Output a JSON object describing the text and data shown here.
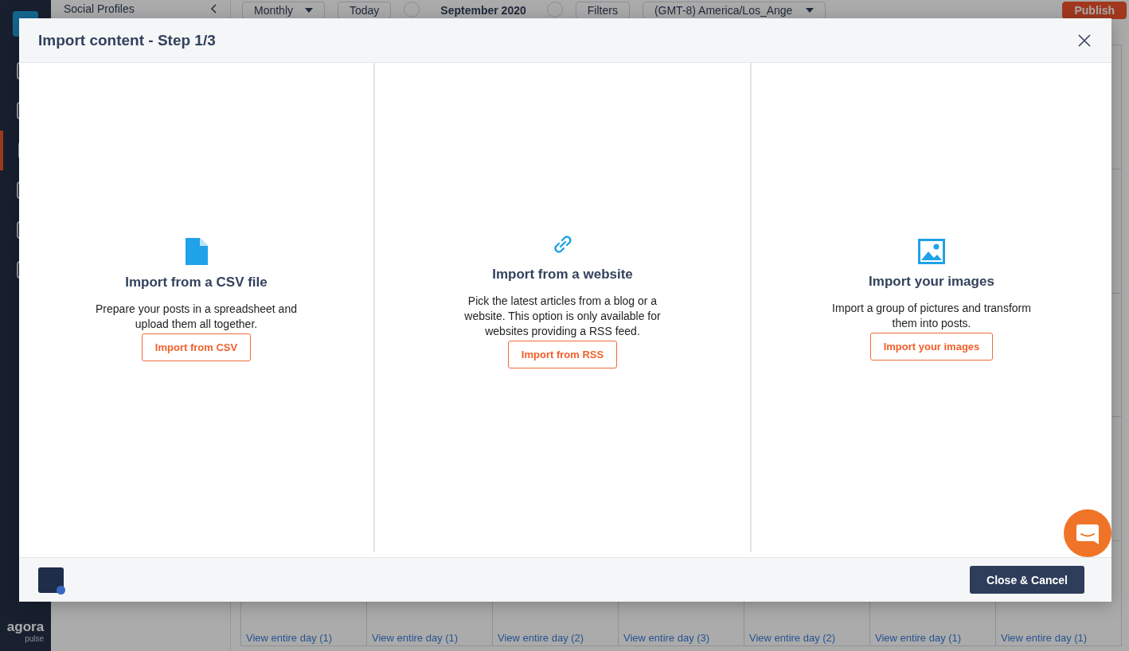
{
  "sidebar": {
    "items": [
      {
        "selected": false
      },
      {
        "selected": false
      },
      {
        "selected": true
      },
      {
        "selected": false
      },
      {
        "selected": false
      },
      {
        "selected": false
      }
    ],
    "logo": "agora",
    "logo_sub": "pulse"
  },
  "profiles_panel": {
    "title": "Social Profiles"
  },
  "toolbar": {
    "view": "Monthly",
    "today": "Today",
    "month": "September 2020",
    "filters": "Filters",
    "timezone": "(GMT-8) America/Los_Ange",
    "publish": "Publish"
  },
  "calendar": {
    "day_links": [
      "View entire day (1)",
      "View entire day (1)",
      "View entire day (2)",
      "View entire day (3)",
      "View entire day (2)",
      "View entire day (1)",
      "View entire day (1)"
    ]
  },
  "modal": {
    "title": "Import content - Step 1/3",
    "options": [
      {
        "kind": "file",
        "title": "Import from a CSV file",
        "description": "Prepare your posts in a spreadsheet and upload them all together.",
        "button": "Import from CSV"
      },
      {
        "kind": "link",
        "title": "Import from a website",
        "description": "Pick the latest articles from a blog or a website. This option is only available for websites providing a RSS feed.",
        "button": "Import from RSS"
      },
      {
        "kind": "image",
        "title": "Import your images",
        "description": "Import a group of pictures and transform them into posts.",
        "button": "Import your images"
      }
    ],
    "close_button": "Close & Cancel"
  }
}
